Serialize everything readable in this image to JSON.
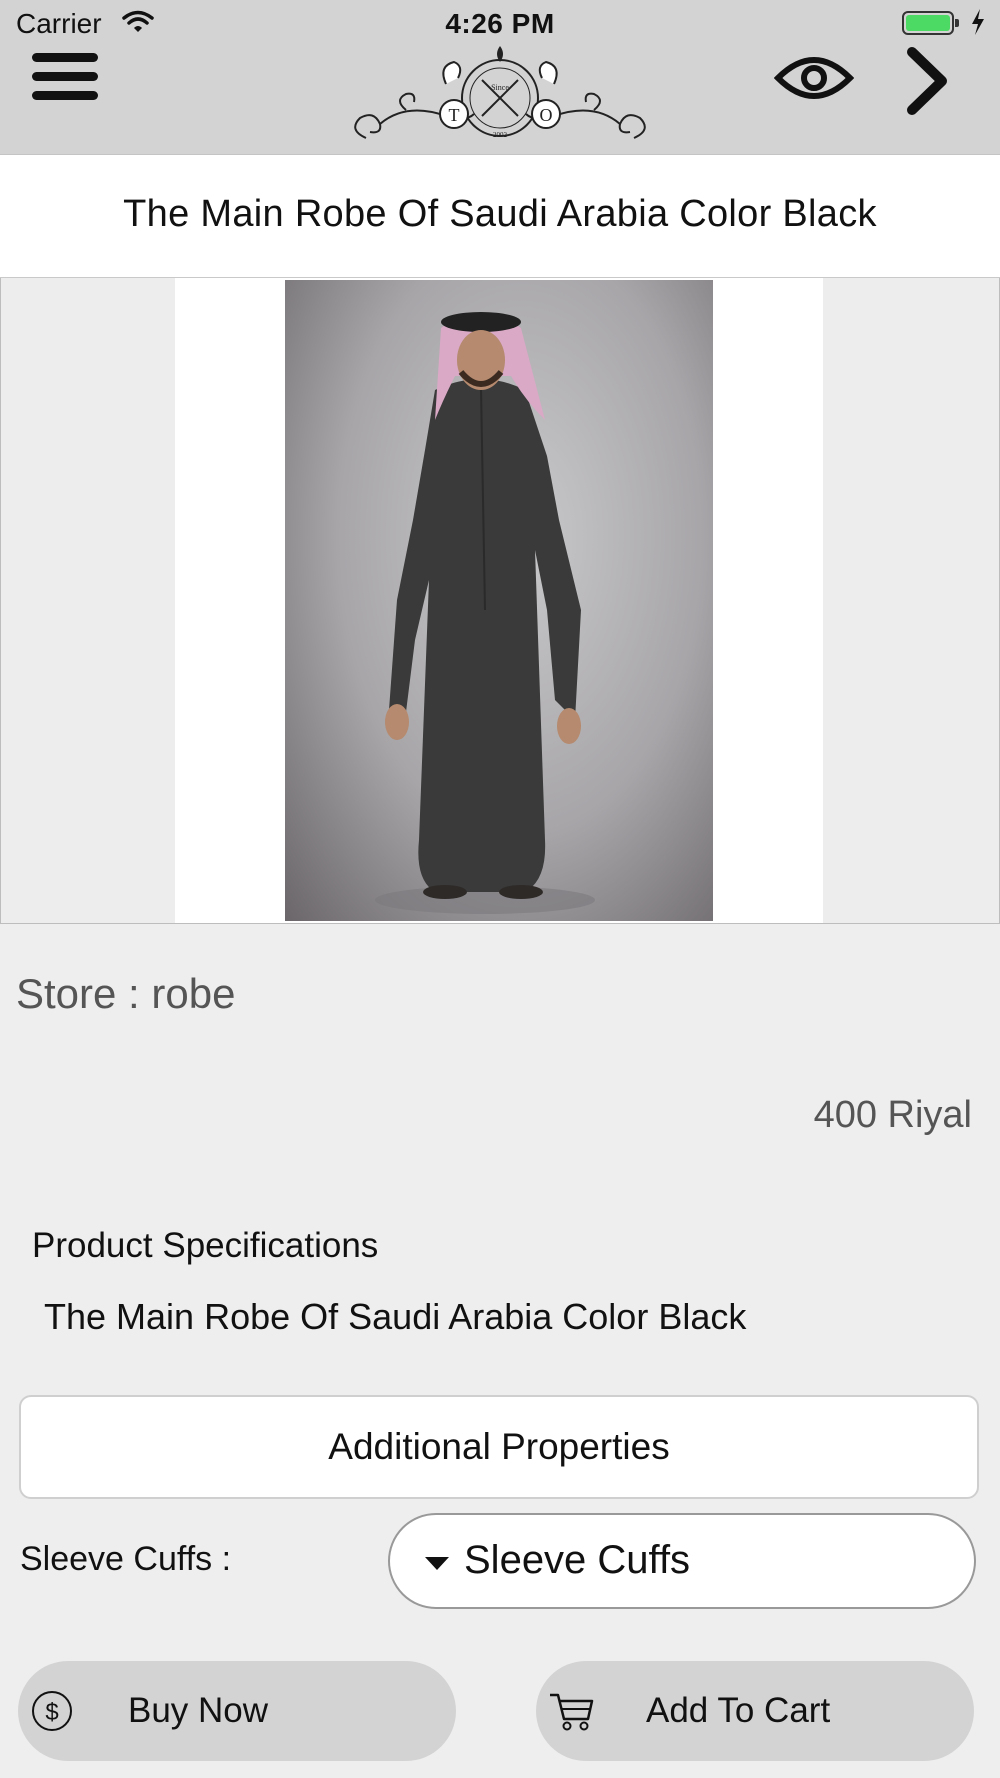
{
  "status_bar": {
    "carrier": "Carrier",
    "time": "4:26 PM",
    "battery_color": "#4cd964"
  },
  "nav": {
    "menu_icon": "hamburger-menu-icon",
    "logo": {
      "since": "Since",
      "year": "2002",
      "letters": [
        "T",
        "X",
        "O"
      ]
    },
    "view_icon": "eye-icon",
    "next_icon": "chevron-right-icon",
    "background": "#d3d3d3"
  },
  "product": {
    "title": "The Main Robe Of Saudi Arabia Color Black",
    "store": "Store : robe",
    "price": "400 Riyal",
    "specifications_heading": "Product Specifications",
    "specifications_text": "The Main Robe Of Saudi Arabia Color Black"
  },
  "additional_properties": {
    "button_label": "Additional Properties",
    "sleeve_cuffs_label": "Sleeve Cuffs :",
    "sleeve_cuffs_value": "Sleeve Cuffs"
  },
  "actions": {
    "buy_now": "Buy Now",
    "buy_icon": "dollar-circle-icon",
    "add_to_cart": "Add To Cart",
    "cart_icon": "shopping-cart-icon"
  }
}
